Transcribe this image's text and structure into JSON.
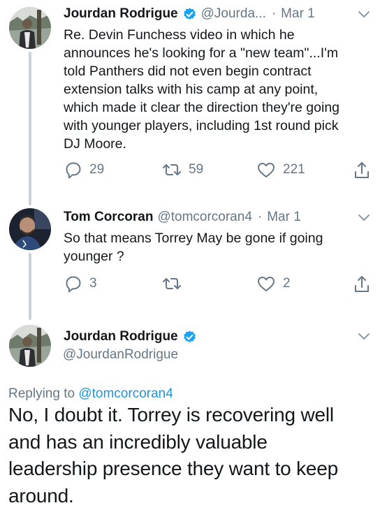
{
  "tweets": [
    {
      "name": "Jourdan Rodrigue",
      "handle": "@Jourda...",
      "separator": "·",
      "date": "Mar 1",
      "text": "Re. Devin Funchess video in which he announces he's looking for a \"new team\"...I'm told Panthers did not even begin contract extension talks with his camp at any point, which made it clear the direction they're going with younger players, including 1st round pick DJ Moore.",
      "lines": [
        "Re. Devin Funchess video in which he",
        "announces he's looking for a \"new team\"...I'm",
        "told Panthers did not even begin contract",
        "extension talks with his camp at any point,",
        "which made it clear the direction they're going",
        "with younger players, including 1st round pick",
        "DJ Moore."
      ],
      "replies": "29",
      "retweets": "59",
      "likes": "221",
      "verified": true
    },
    {
      "name": "Tom Corcoran",
      "handle": "@tomcorcoran4",
      "separator": "·",
      "date": "Mar 1",
      "lines": [
        "So that means Torrey May be gone if going",
        "younger ?"
      ],
      "replies": "3",
      "retweets": "",
      "likes": "2",
      "verified": false
    }
  ],
  "focused": {
    "name": "Jourdan Rodrigue",
    "handle": "@JourdanRodrigue",
    "replying_prefix": "Replying to",
    "replying_to": "@tomcorcoran4",
    "text": "No, I doubt it. Torrey is recovering well and has an incredibly valuable leadership presence they want to keep around.",
    "lines": [
      "No, I doubt it. Torrey is recovering well",
      "and has an incredibly valuable",
      "leadership presence they want to keep",
      "around."
    ],
    "verified": true
  },
  "colors": {
    "text": "#14171a",
    "secondary": "#657786",
    "link": "#1b95e0",
    "verified": "#1da1f2",
    "thread_line": "#c9d1d9"
  },
  "icons": [
    "reply-icon",
    "retweet-icon",
    "like-icon",
    "share-icon",
    "chevron-down-icon",
    "verified-badge-icon"
  ]
}
